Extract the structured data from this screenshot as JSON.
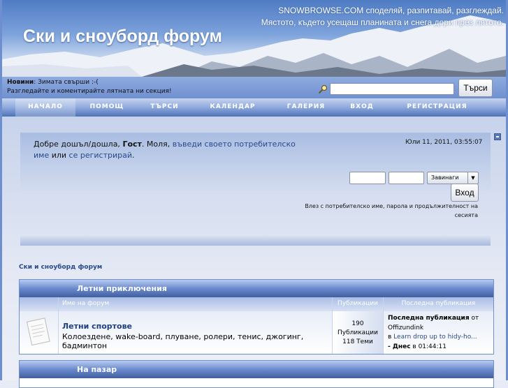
{
  "header": {
    "title": "Ски и сноуборд форум",
    "tagline1": "SNOWBROWSE.COM споделяй, разпитавай, разглеждай.",
    "tagline2": "Мястото, където усещаш планината и снега дори през лятото."
  },
  "news": {
    "label": "Новини",
    "text": ": Зимата свърши :-(",
    "line2": "Разгледайте и коментирайте лятната ни секция!"
  },
  "search": {
    "value": "",
    "button": "Търси"
  },
  "nav": [
    "НАЧАЛО",
    "ПОМОЩ",
    "ТЪРСИ",
    "КАЛЕНДАР",
    "ГАЛЕРИЯ",
    "ВХОД",
    "РЕГИСТРАЦИЯ"
  ],
  "welcome": {
    "greeting": "Добре дошъл/дошла, ",
    "guest": "Гост",
    "please": ". Моля, ",
    "login_link": "въведи своето потребителско име",
    "or": " или ",
    "register_link": "се регистрирай",
    "end": ".",
    "date": "Юли 11, 2011, 03:55:07"
  },
  "login": {
    "username": "",
    "password": "",
    "duration": "Завинаги",
    "button": "Вход",
    "hint": "Влез с потребителско име, парола и продължителност на сесията"
  },
  "breadcrumb": "Ски и сноуборд форум",
  "categories": [
    {
      "name": "Летни приключения",
      "columns": [
        "Име на форум",
        "Публикации",
        "Последна публикация"
      ],
      "boards": [
        {
          "name": "Летни спортове",
          "description": "Колоездене, wake-board, плуване, ролери, тенис, джогинг, бадминтон",
          "posts": "190",
          "posts_label": "Публикации",
          "topics": "118 Теми",
          "last_label": "Последна публикация",
          "last_by": " от",
          "last_user": "Offizundink",
          "in": "в ",
          "last_topic": "Learn drop up to hidy-ho...",
          "last_time_prefix": "- Днес",
          "last_time": " в 01:44:11"
        }
      ]
    },
    {
      "name": "На пазар"
    }
  ]
}
